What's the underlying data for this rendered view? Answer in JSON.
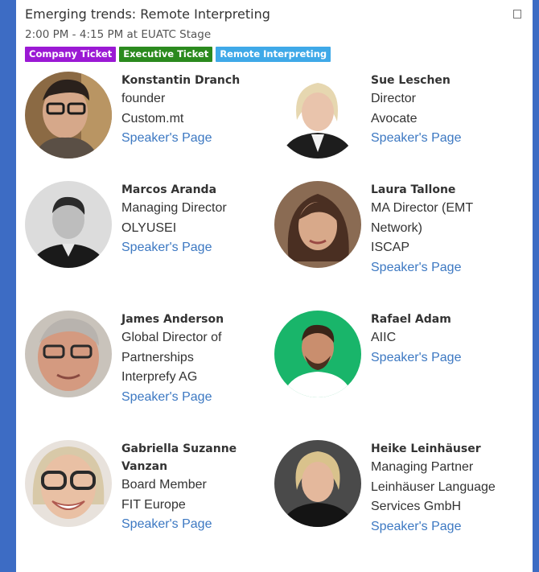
{
  "event": {
    "title": "Emerging trends: Remote Interpreting",
    "time": "2:00 PM - 4:15 PM at EUATC Stage",
    "tags": [
      {
        "label": "Company Ticket",
        "color": "#9b19d4"
      },
      {
        "label": "Executive Ticket",
        "color": "#2b8a1e"
      },
      {
        "label": "Remote Interpreting",
        "color": "#3fa9e8"
      }
    ]
  },
  "speakers": [
    {
      "name": "Konstantin Dranch",
      "lines": [
        "founder",
        "Custom.mt"
      ],
      "link": "Speaker's Page",
      "avatar_icon": "person-photo-icon"
    },
    {
      "name": "Sue Leschen",
      "lines": [
        "Director",
        "Avocate"
      ],
      "link": "Speaker's Page",
      "avatar_icon": "person-photo-icon"
    },
    {
      "name": "Marcos Aranda",
      "lines": [
        "Managing Director",
        "OLYUSEI"
      ],
      "link": "Speaker's Page",
      "avatar_icon": "person-photo-icon"
    },
    {
      "name": "Laura Tallone",
      "lines": [
        "MA Director (EMT",
        "Network)",
        "ISCAP"
      ],
      "link": "Speaker's Page",
      "avatar_icon": "person-photo-icon"
    },
    {
      "name": "James Anderson",
      "lines": [
        "Global Director of",
        "Partnerships",
        "Interprefy AG"
      ],
      "link": "Speaker's Page",
      "avatar_icon": "person-photo-icon"
    },
    {
      "name": "Rafael Adam",
      "lines": [
        "AIIC"
      ],
      "link": "Speaker's Page",
      "avatar_icon": "person-photo-icon"
    },
    {
      "name": "Gabriella Suzanne",
      "name2": "Vanzan",
      "lines": [
        "Board Member",
        "FIT Europe"
      ],
      "link": "Speaker's Page",
      "avatar_icon": "person-photo-icon"
    },
    {
      "name": "Heike Leinhäuser",
      "lines": [
        "Managing Partner",
        "Leinhäuser Language",
        "Services GmbH"
      ],
      "link": "Speaker's Page",
      "avatar_icon": "person-photo-icon"
    }
  ]
}
